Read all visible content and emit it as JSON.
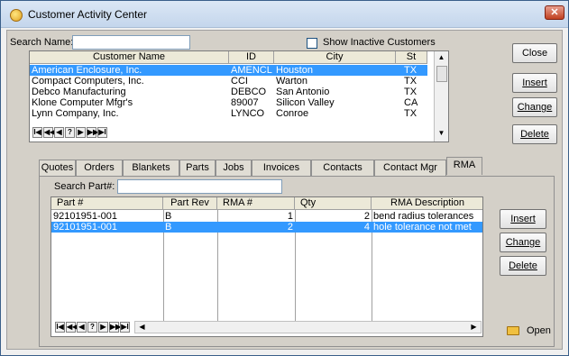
{
  "window": {
    "title": "Customer Activity Center"
  },
  "search": {
    "label": "Search Name:",
    "value": ""
  },
  "inactive": {
    "label": "Show Inactive Customers"
  },
  "customers": {
    "columns": [
      "Customer Name",
      "ID",
      "City",
      "St"
    ],
    "rows": [
      [
        "American Enclosure, Inc.",
        "AMENCL",
        "Houston",
        "TX"
      ],
      [
        "Compact Computers, Inc.",
        "CCI",
        "Warton",
        "TX"
      ],
      [
        "Debco Manufacturing",
        "DEBCO",
        "San Antonio",
        "TX"
      ],
      [
        "Klone Computer Mfgr's",
        "89007",
        "Silicon Valley",
        "CA"
      ],
      [
        "Lynn Company, Inc.",
        "LYNCO",
        "Conroe",
        "TX"
      ]
    ],
    "selected_index": 0
  },
  "nav": [
    "I◀",
    "◀◀",
    "◀",
    "?",
    "▶",
    "▶▶",
    "▶I"
  ],
  "buttons": {
    "close": "Close",
    "insert": "Insert",
    "change": "Change",
    "delete": "Delete"
  },
  "tabs": [
    "Quotes",
    "Orders",
    "Blankets",
    "Parts",
    "Jobs",
    "Invoices",
    "Contacts",
    "Contact Mgr",
    "RMA"
  ],
  "active_tab": "RMA",
  "rma": {
    "search_label": "Search Part#:",
    "search_value": "",
    "columns": [
      "Part #",
      "Part Rev",
      "RMA #",
      "Qty",
      "RMA Description"
    ],
    "rows": [
      [
        "92101951-001",
        "B",
        "1",
        "2",
        "bend radius tolerances"
      ],
      [
        "92101951-001",
        "B",
        "2",
        "4",
        "hole tolerance not met"
      ]
    ],
    "selected_index": 1,
    "buttons": {
      "insert": "Insert",
      "change": "Change",
      "delete": "Delete"
    },
    "open_label": "Open"
  }
}
